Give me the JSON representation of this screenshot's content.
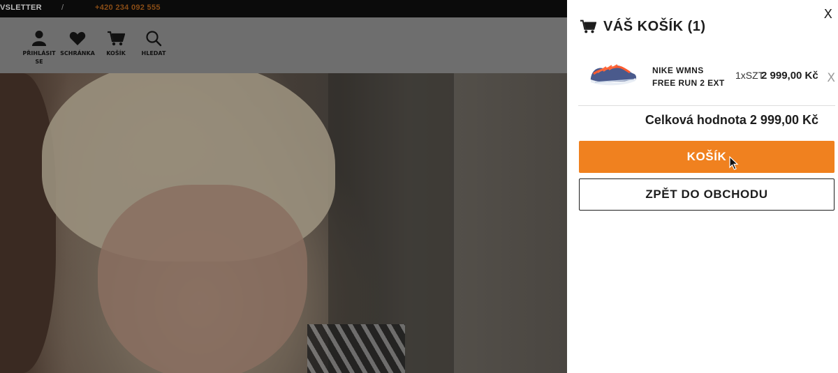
{
  "colors": {
    "accent": "#f0811f",
    "drawer_bg": "#ffffff",
    "text_dark": "#1d1d1d",
    "topbar_bg": "#0b0b0b",
    "navbar_bg": "#6e6e6e"
  },
  "topbar": {
    "newsletter": "VSLETTER",
    "separator": "/",
    "phone": "+420 234 092 555"
  },
  "nav": {
    "login": "PŘIHLÁSIT SE",
    "wishlist": "SCHRÁNKA",
    "cart": "KOŠÍK",
    "search": "HLEDAT",
    "icons": [
      "user-icon",
      "heart-icon",
      "cart-icon",
      "search-icon"
    ]
  },
  "drawer": {
    "close": "X",
    "title": "VÁŠ KOŠÍK (1)",
    "title_icon": "cart-icon",
    "items": [
      {
        "name": "NIKE WMNS FREE RUN 2 EXT",
        "quantity": "1xSZT",
        "price": "2 999,00 Kč",
        "remove": "X",
        "thumb_icon": "sneaker-thumbnail"
      }
    ],
    "total_label": "Celková hodnota",
    "total_amount": "2 999,00 Kč",
    "checkout_button": "KOŠÍK",
    "continue_button": "ZPĚT DO OBCHODU"
  }
}
